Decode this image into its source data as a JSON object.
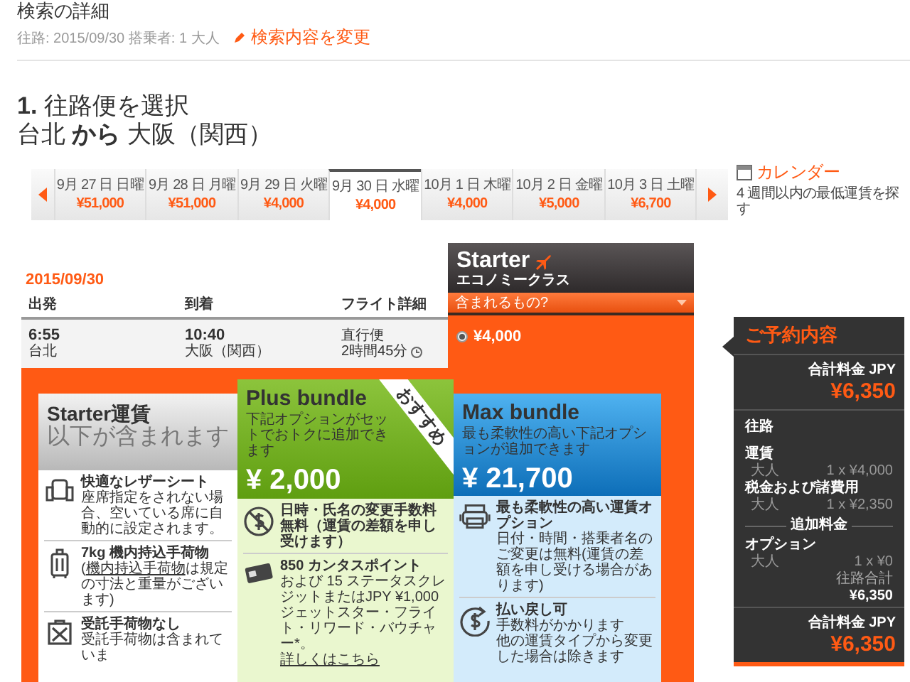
{
  "search": {
    "title": "検索の詳細",
    "summary": "往路: 2015/09/30 搭乗者: 1 大人",
    "change_link": "検索内容を変更"
  },
  "step": {
    "number": "1.",
    "title": "往路便を選択",
    "origin": "台北",
    "connector": "から",
    "destination": "大阪（関西）"
  },
  "dates": [
    {
      "label": "9月 27 日 日曜",
      "price": "¥51,000",
      "selected": false
    },
    {
      "label": "9月 28 日 月曜",
      "price": "¥51,000",
      "selected": false
    },
    {
      "label": "9月 29 日 火曜",
      "price": "¥4,000",
      "selected": false
    },
    {
      "label": "9月 30 日 水曜",
      "price": "¥4,000",
      "selected": true
    },
    {
      "label": "10月 1 日 木曜",
      "price": "¥4,000",
      "selected": false
    },
    {
      "label": "10月 2 日 金曜",
      "price": "¥5,000",
      "selected": false
    },
    {
      "label": "10月 3 日 土曜",
      "price": "¥6,700",
      "selected": false
    }
  ],
  "calendar": {
    "link": "カレンダー",
    "note": "4 週間以内の最低運賃を探す"
  },
  "flight": {
    "date": "2015/09/30",
    "columns": [
      "出発",
      "到着",
      "フライト詳細"
    ],
    "depart_time": "6:55",
    "depart_city": "台北",
    "arrive_time": "10:40",
    "arrive_city": "大阪（関西）",
    "type": "直行便",
    "duration": "2時間45分"
  },
  "fare": {
    "name": "Starter",
    "class": "エコノミークラス",
    "dropdown": "含まれるもの?",
    "price": "¥4,000",
    "selected": true
  },
  "bundles": [
    {
      "kind": "starter",
      "name": "Starter運賃",
      "subtitle": "以下が含まれます",
      "features": [
        {
          "kind": "seat",
          "title": "快適なレザーシート",
          "body": [
            {
              "text": "座席指定をされない場合、空いている席に自動的に設定されます。"
            }
          ]
        },
        {
          "kind": "bag",
          "title": "7kg 機内持込手荷物",
          "body": [
            {
              "before": "(",
              "link": "機内持込手荷物",
              "after": "は規定の寸法と重量がございます)"
            }
          ]
        },
        {
          "kind": "no-bag",
          "title": "受託手荷物なし",
          "body": [
            {
              "text": "受託手荷物は含まれていま"
            }
          ]
        }
      ]
    },
    {
      "kind": "plus",
      "name": "Plus bundle",
      "description": "下記オプションがセットでおトクに追加できます",
      "price": "¥ 2,000",
      "ribbon": "おすすめ",
      "features": [
        {
          "kind": "no-fee",
          "title": "日時・氏名の変更手数料無料（運賃の差額を申し受けます）"
        },
        {
          "kind": "card",
          "title": "850 カンタスポイント",
          "body": [
            {
              "text": "および 15 ステータスクレジットまたはJPY ¥1,000ジェットスター・フライト・リワード・バウチャー*。"
            },
            {
              "link": "詳しくはこちら"
            }
          ]
        }
      ]
    },
    {
      "kind": "max",
      "name": "Max bundle",
      "description": "最も柔軟性の高い下記オプションが追加できます",
      "price": "¥ 21,700",
      "features": [
        {
          "kind": "flex",
          "title": "最も柔軟性の高い運賃オプション",
          "body": [
            {
              "text": "日付・時間・搭乗者名のご変更は無料(運賃の差額を申し受ける場合があります)"
            }
          ]
        },
        {
          "kind": "refund",
          "title": "払い戻し可",
          "body": [
            {
              "text": "手数料がかかります"
            },
            {
              "text": "他の運賃タイプから変更した場合は除きます"
            }
          ]
        }
      ]
    }
  ],
  "summary": {
    "title": "ご予約内容",
    "total_label": "合計料金 JPY",
    "total": "¥6,350",
    "section": "往路",
    "items": [
      {
        "label": "運賃",
        "passenger": "大人",
        "amount": "1 x ¥4,000"
      },
      {
        "label": "税金および諸費用",
        "passenger": "大人",
        "amount": "1 x ¥2,350"
      }
    ],
    "extra_label": "追加料金",
    "extras": [
      {
        "label": "オプション",
        "passenger": "大人",
        "amount": "1 x ¥0"
      }
    ],
    "subtotal_label": "往路合計",
    "subtotal": "¥6,350",
    "footer_label": "合計料金 JPY",
    "footer_total": "¥6,350"
  }
}
